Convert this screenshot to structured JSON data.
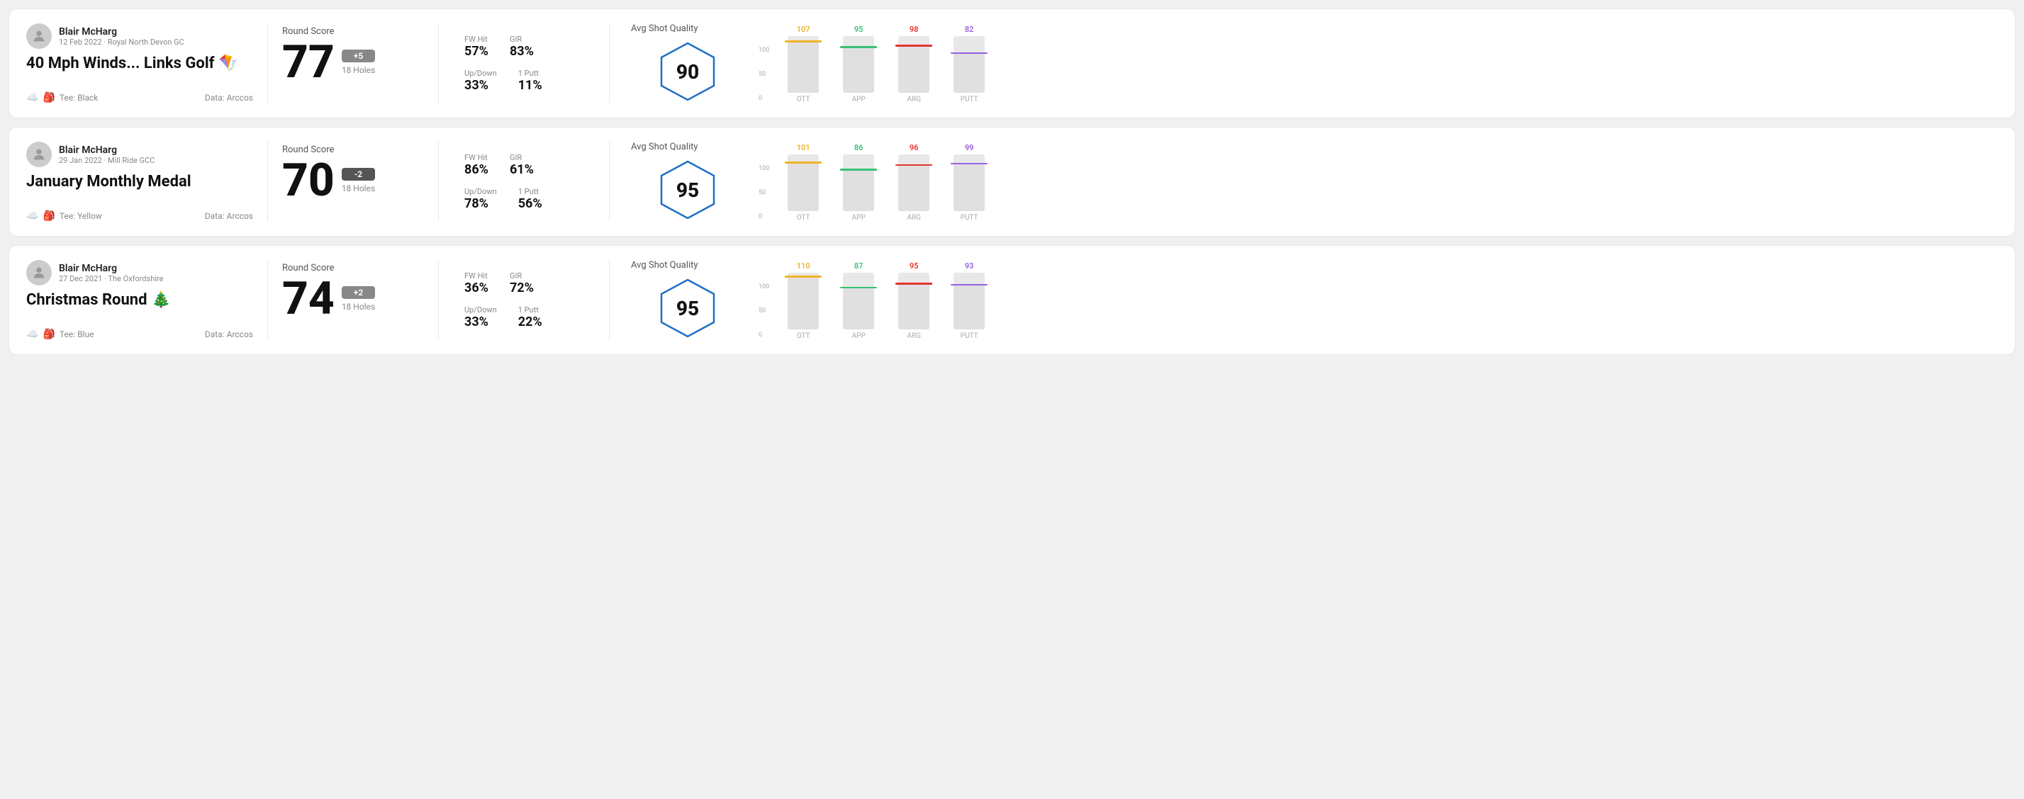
{
  "cards": [
    {
      "id": "card1",
      "user": {
        "name": "Blair McHarg",
        "date_course": "12 Feb 2022 · Royal North Devon GC"
      },
      "title": "40 Mph Winds... Links Golf",
      "title_emoji": "🪁",
      "tee": "Black",
      "data_source": "Data: Arccos",
      "round_score_label": "Round Score",
      "score": "77",
      "score_diff": "+5",
      "score_diff_type": "positive",
      "holes": "18 Holes",
      "fw_hit_label": "FW Hit",
      "fw_hit": "57%",
      "gir_label": "GIR",
      "gir": "83%",
      "updown_label": "Up/Down",
      "updown": "33%",
      "oneputt_label": "1 Putt",
      "oneputt": "11%",
      "avg_quality_label": "Avg Shot Quality",
      "quality_score": "90",
      "bars": [
        {
          "label": "OTT",
          "value": 107,
          "color": "#f0b429"
        },
        {
          "label": "APP",
          "value": 95,
          "color": "#38c172"
        },
        {
          "label": "ARG",
          "value": 98,
          "color": "#e3342f"
        },
        {
          "label": "PUTT",
          "value": 82,
          "color": "#9561e2"
        }
      ]
    },
    {
      "id": "card2",
      "user": {
        "name": "Blair McHarg",
        "date_course": "29 Jan 2022 · Mill Ride GCC"
      },
      "title": "January Monthly Medal",
      "title_emoji": "",
      "tee": "Yellow",
      "data_source": "Data: Arccos",
      "round_score_label": "Round Score",
      "score": "70",
      "score_diff": "-2",
      "score_diff_type": "negative",
      "holes": "18 Holes",
      "fw_hit_label": "FW Hit",
      "fw_hit": "86%",
      "gir_label": "GIR",
      "gir": "61%",
      "updown_label": "Up/Down",
      "updown": "78%",
      "oneputt_label": "1 Putt",
      "oneputt": "56%",
      "avg_quality_label": "Avg Shot Quality",
      "quality_score": "95",
      "bars": [
        {
          "label": "OTT",
          "value": 101,
          "color": "#f0b429"
        },
        {
          "label": "APP",
          "value": 86,
          "color": "#38c172"
        },
        {
          "label": "ARG",
          "value": 96,
          "color": "#e3342f"
        },
        {
          "label": "PUTT",
          "value": 99,
          "color": "#9561e2"
        }
      ]
    },
    {
      "id": "card3",
      "user": {
        "name": "Blair McHarg",
        "date_course": "27 Dec 2021 · The Oxfordshire"
      },
      "title": "Christmas Round",
      "title_emoji": "🎄",
      "tee": "Blue",
      "data_source": "Data: Arccos",
      "round_score_label": "Round Score",
      "score": "74",
      "score_diff": "+2",
      "score_diff_type": "positive",
      "holes": "18 Holes",
      "fw_hit_label": "FW Hit",
      "fw_hit": "36%",
      "gir_label": "GIR",
      "gir": "72%",
      "updown_label": "Up/Down",
      "updown": "33%",
      "oneputt_label": "1 Putt",
      "oneputt": "22%",
      "avg_quality_label": "Avg Shot Quality",
      "quality_score": "95",
      "bars": [
        {
          "label": "OTT",
          "value": 110,
          "color": "#f0b429"
        },
        {
          "label": "APP",
          "value": 87,
          "color": "#38c172"
        },
        {
          "label": "ARG",
          "value": 95,
          "color": "#e3342f"
        },
        {
          "label": "PUTT",
          "value": 93,
          "color": "#9561e2"
        }
      ]
    }
  ]
}
